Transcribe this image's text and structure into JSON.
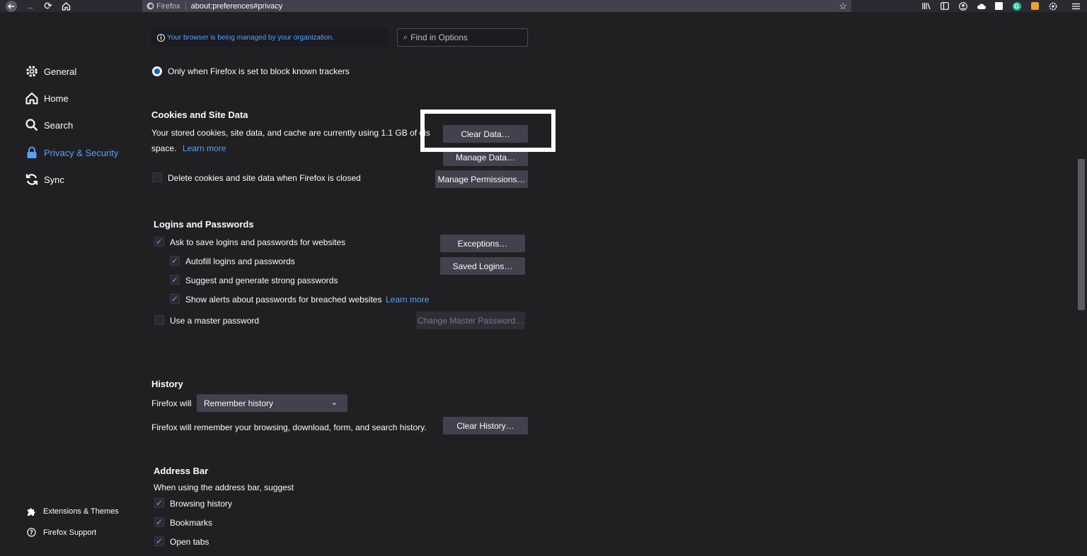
{
  "toolbar": {
    "back_icon": "arrow-left-icon",
    "forward_icon": "arrow-right-icon",
    "reload_icon": "reload-icon",
    "home_icon": "home-icon",
    "identity_label": "Firefox",
    "url": "about:preferences#privacy"
  },
  "sidebar": {
    "items": [
      {
        "label": "General",
        "icon": "gear-icon"
      },
      {
        "label": "Home",
        "icon": "home-icon"
      },
      {
        "label": "Search",
        "icon": "search-icon"
      },
      {
        "label": "Privacy & Security",
        "icon": "lock-icon",
        "active": true
      },
      {
        "label": "Sync",
        "icon": "sync-icon"
      }
    ],
    "footer": [
      {
        "label": "Extensions & Themes",
        "icon": "puzzle-icon"
      },
      {
        "label": "Firefox Support",
        "icon": "help-icon"
      }
    ]
  },
  "banner": {
    "managed_text": "Your browser is being managed by your organization.",
    "find_placeholder": "Find in Options"
  },
  "tracking": {
    "radio_label": "Only when Firefox is set to block known trackers"
  },
  "cookies": {
    "heading": "Cookies and Site Data",
    "desc_line1": "Your stored cookies, site data, and cache are currently using 1.1 GB of dis",
    "desc_line2": "space.",
    "learn_more": "Learn more",
    "delete_label": "Delete cookies and site data when Firefox is closed",
    "clear_data": "Clear Data…",
    "manage_data": "Manage Data…",
    "manage_permissions": "Manage Permissions…"
  },
  "logins": {
    "heading": "Logins and Passwords",
    "ask_save": "Ask to save logins and passwords for websites",
    "autofill": "Autofill logins and passwords",
    "suggest": "Suggest and generate strong passwords",
    "alerts": "Show alerts about passwords for breached websites",
    "learn_more": "Learn more",
    "master": "Use a master password",
    "exceptions": "Exceptions…",
    "saved_logins": "Saved Logins…",
    "change_master": "Change Master Password…"
  },
  "history": {
    "heading": "History",
    "firefox_will": "Firefox will",
    "select_value": "Remember history",
    "desc": "Firefox will remember your browsing, download, form, and search history.",
    "clear_history": "Clear History…"
  },
  "address_bar": {
    "heading": "Address Bar",
    "suggest": "When using the address bar, suggest",
    "browsing_history": "Browsing history",
    "bookmarks": "Bookmarks",
    "open_tabs": "Open tabs"
  },
  "colors": {
    "accent": "#54a3f5",
    "background": "#202023",
    "button": "#42414d"
  }
}
